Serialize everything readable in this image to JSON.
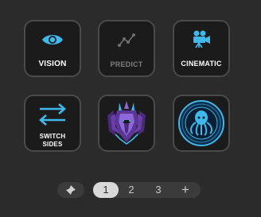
{
  "tiles": {
    "vision": {
      "label": "VISION",
      "icon": "eye-icon"
    },
    "predict": {
      "label": "PREDICT",
      "icon": "trend-line-icon",
      "state": "disabled"
    },
    "cinematic": {
      "label": "CINEMATIC",
      "icon": "movie-camera-icon"
    },
    "switch_sides": {
      "line1": "SWITCH",
      "line2": "SIDES",
      "icon": "swap-arrows-icon"
    },
    "knight": {
      "icon": "knight-emblem-icon"
    },
    "kraken": {
      "icon": "kraken-emblem-icon"
    }
  },
  "pager": {
    "pin_icon": "pin-icon",
    "pages": [
      "1",
      "2",
      "3"
    ],
    "active_page": "1",
    "add_label": "+"
  },
  "colors": {
    "background": "#2b2b2b",
    "tile_background": "#1b1b1c",
    "tile_border": "#4a4a4a",
    "icon_accent": "#3fb8ec",
    "disabled_icon": "#6f6f6f"
  }
}
